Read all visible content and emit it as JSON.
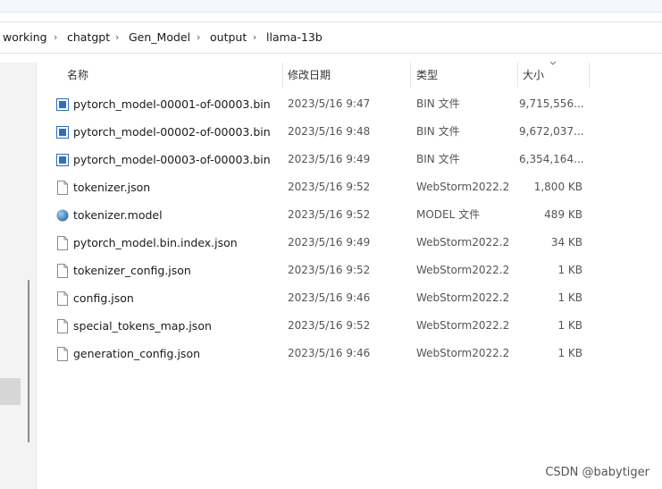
{
  "breadcrumb": {
    "items": [
      "working",
      "chatgpt",
      "Gen_Model",
      "output",
      "llama-13b"
    ],
    "separator": "›"
  },
  "columns": {
    "name": "名称",
    "modified": "修改日期",
    "type": "类型",
    "size": "大小"
  },
  "files": [
    {
      "name": "pytorch_model-00001-of-00003.bin",
      "modified": "2023/5/16 9:47",
      "type": "BIN 文件",
      "size": "9,715,556...",
      "icon": "bin-file-icon"
    },
    {
      "name": "pytorch_model-00002-of-00003.bin",
      "modified": "2023/5/16 9:48",
      "type": "BIN 文件",
      "size": "9,672,037...",
      "icon": "bin-file-icon"
    },
    {
      "name": "pytorch_model-00003-of-00003.bin",
      "modified": "2023/5/16 9:49",
      "type": "BIN 文件",
      "size": "6,354,164...",
      "icon": "bin-file-icon"
    },
    {
      "name": "tokenizer.json",
      "modified": "2023/5/16 9:52",
      "type": "WebStorm2022.2",
      "size": "1,800 KB",
      "icon": "json-file-icon"
    },
    {
      "name": "tokenizer.model",
      "modified": "2023/5/16 9:52",
      "type": "MODEL 文件",
      "size": "489 KB",
      "icon": "model-file-icon"
    },
    {
      "name": "pytorch_model.bin.index.json",
      "modified": "2023/5/16 9:49",
      "type": "WebStorm2022.2",
      "size": "34 KB",
      "icon": "json-file-icon"
    },
    {
      "name": "tokenizer_config.json",
      "modified": "2023/5/16 9:52",
      "type": "WebStorm2022.2",
      "size": "1 KB",
      "icon": "json-file-icon"
    },
    {
      "name": "config.json",
      "modified": "2023/5/16 9:46",
      "type": "WebStorm2022.2",
      "size": "1 KB",
      "icon": "json-file-icon"
    },
    {
      "name": "special_tokens_map.json",
      "modified": "2023/5/16 9:52",
      "type": "WebStorm2022.2",
      "size": "1 KB",
      "icon": "json-file-icon"
    },
    {
      "name": "generation_config.json",
      "modified": "2023/5/16 9:46",
      "type": "WebStorm2022.2",
      "size": "1 KB",
      "icon": "json-file-icon"
    }
  ],
  "watermark": "CSDN @babytiger",
  "colors": {
    "bin_icon_blue": "#2f6fc0",
    "model_icon_blue": "#3f8fd0",
    "separator_gray": "#e5e5e5"
  }
}
